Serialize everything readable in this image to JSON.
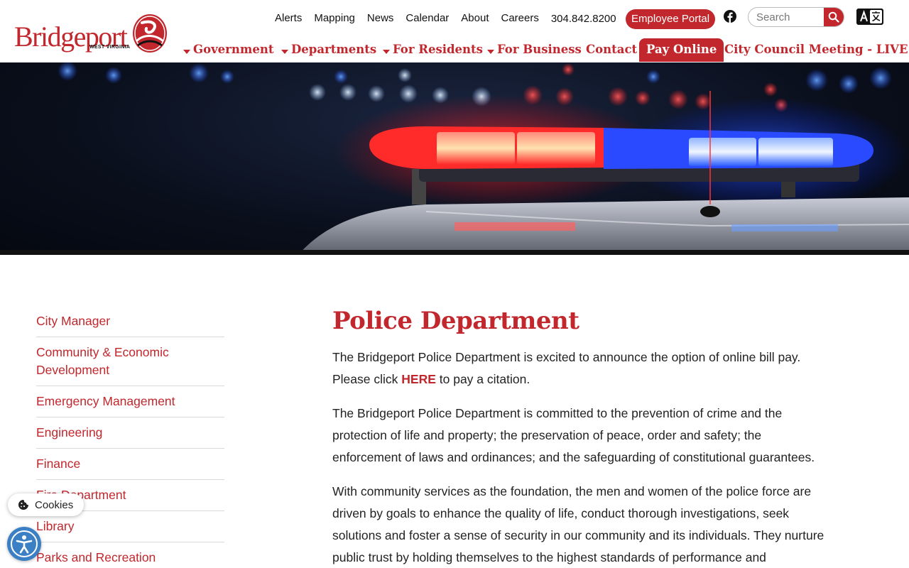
{
  "logo": {
    "wordmark": "Bridgeport",
    "state": "WEST VIRGINIA"
  },
  "utility_nav": [
    {
      "label": "Alerts"
    },
    {
      "label": "Mapping"
    },
    {
      "label": "News"
    },
    {
      "label": "Calendar"
    },
    {
      "label": "About"
    },
    {
      "label": "Careers"
    }
  ],
  "phone": "304.842.8200",
  "employee_portal": "Employee Portal",
  "search": {
    "placeholder": "Search"
  },
  "main_nav": {
    "government": "Government",
    "departments": "Departments",
    "for_residents": "For Residents",
    "for_business": "For Business",
    "contact": "Contact",
    "pay_online": "Pay Online",
    "council_live": "City Council Meeting - LIVE"
  },
  "sidebar": {
    "items": [
      {
        "label": "City Manager"
      },
      {
        "label": "Community & Economic Development"
      },
      {
        "label": "Emergency Management"
      },
      {
        "label": "Engineering"
      },
      {
        "label": "Finance"
      },
      {
        "label": "Fire Department"
      },
      {
        "label": "Library"
      },
      {
        "label": "Parks and Recreation"
      }
    ]
  },
  "content": {
    "title": "Police Department",
    "p1_before": "The Bridgeport Police Department is excited to announce the option of online bill pay. Please click ",
    "p1_link": "HERE",
    "p1_after": " to pay a citation.",
    "p2": "The Bridgeport Police Department is committed to the prevention of crime and the protection of life and property; the preservation of peace, order and safety; the enforcement of laws and ordinances; and the safeguarding of constitutional guarantees.",
    "p3": "With community services as the foundation, the men and women of the police force are driven by goals to enhance the quality of life, conduct thorough investigations, seek solutions and foster a sense of security in our community and its individuals. They nurture public trust by holding themselves to the highest standards of performance and"
  },
  "cookies_label": "Cookies",
  "colors": {
    "brand_red": "#c1272d",
    "a11y_blue": "#3b7fc4"
  }
}
